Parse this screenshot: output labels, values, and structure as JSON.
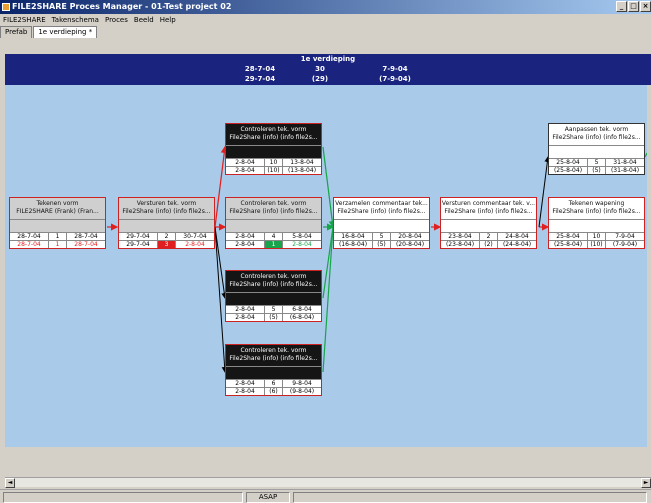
{
  "window": {
    "title": "FILE2SHARE Proces Manager - 01-Test project 02",
    "btn_min": "_",
    "btn_max": "□",
    "btn_close": "×"
  },
  "menu": [
    "FILE2SHARE",
    "Takenschema",
    "Proces",
    "Beeld",
    "Help"
  ],
  "tabs": [
    "Prefab",
    "1e verdieping *"
  ],
  "header": {
    "title": "1e verdieping",
    "row1": [
      "28-7-04",
      "30",
      "7-9-04"
    ],
    "row2": [
      "29-7-04",
      "(29)",
      "(7-9-04)"
    ]
  },
  "status": {
    "mode": "ASAP"
  },
  "scroll": {
    "left_arrow": "◄",
    "right_arrow": "►"
  },
  "colors": {
    "dark_node": "#151515",
    "grey_node": "#cfcfcf",
    "link_red": "#e02020",
    "link_green": "#17a44a",
    "link_black": "#000000",
    "header_bg": "#1a237e",
    "canvas_bg": "#a9cbe9"
  },
  "nodes": [
    {
      "title": "Tekenen vorm",
      "sub": "FILE2SHARE (Frank) (Fran...",
      "r1": [
        "28-7-04",
        "1",
        "28-7-04"
      ],
      "r2": [
        "28-7-04",
        "1",
        "28-7-04"
      ]
    },
    {
      "title": "Versturen tek. vorm",
      "sub": "File2Share (info) (info file2s...",
      "r1": [
        "29-7-04",
        "2",
        "30-7-04"
      ],
      "r2": [
        "29-7-04",
        "3",
        "2-8-04"
      ]
    },
    {
      "title": "Controleren tek. vorm",
      "sub": "File2Share (info) (info file2s...",
      "r1": [
        "2-8-04",
        "10",
        "13-8-04"
      ],
      "r2": [
        "2-8-04",
        "(10)",
        "(13-8-04)"
      ]
    },
    {
      "title": "Controleren tek. vorm",
      "sub": "File2Share (info) (info file2s...",
      "r1": [
        "2-8-04",
        "4",
        "5-8-04"
      ],
      "r2": [
        "2-8-04",
        "1",
        "2-8-04"
      ]
    },
    {
      "title": "Controleren tek. vorm",
      "sub": "File2Share (info) (info file2s...",
      "r1": [
        "2-8-04",
        "5",
        "6-8-04"
      ],
      "r2": [
        "2-8-04",
        "(5)",
        "(6-8-04)"
      ]
    },
    {
      "title": "Controleren tek. vorm",
      "sub": "File2Share (info) (info file2s...",
      "r1": [
        "2-8-04",
        "6",
        "9-8-04"
      ],
      "r2": [
        "2-8-04",
        "(6)",
        "(9-8-04)"
      ]
    },
    {
      "title": "Verzamelen commentaar tek...",
      "sub": "File2Share (info) (info file2s...",
      "r1": [
        "16-8-04",
        "5",
        "20-8-04"
      ],
      "r2": [
        "(16-8-04)",
        "(5)",
        "(20-8-04)"
      ]
    },
    {
      "title": "Versturen commentaar tek. v...",
      "sub": "File2Share (info) (info file2s...",
      "r1": [
        "23-8-04",
        "2",
        "24-8-04"
      ],
      "r2": [
        "(23-8-04)",
        "(2)",
        "(24-8-04)"
      ]
    },
    {
      "title": "Aanpassen tek. vorm",
      "sub": "File2Share (info) (info file2s...",
      "r1": [
        "25-8-04",
        "5",
        "31-8-04"
      ],
      "r2": [
        "(25-8-04)",
        "(5)",
        "(31-8-04)"
      ]
    },
    {
      "title": "Tekenen wapening",
      "sub": "File2Share (info) (info file2s...",
      "r1": [
        "25-8-04",
        "10",
        "7-9-04"
      ],
      "r2": [
        "(25-8-04)",
        "(10)",
        "(7-9-04)"
      ]
    }
  ]
}
